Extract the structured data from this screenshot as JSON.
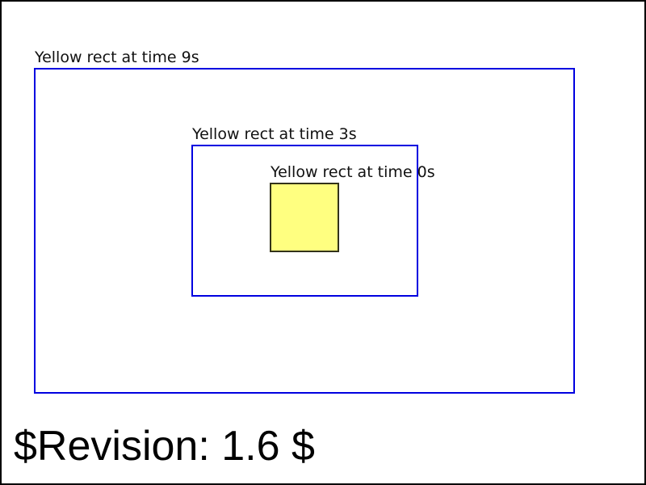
{
  "colors": {
    "frame_border": "#000000",
    "outline_stroke": "#0000e0",
    "square_fill": "#ffff80",
    "square_stroke": "#33331a"
  },
  "diagram": {
    "rect_9s_label": "Yellow rect at time 9s",
    "rect_3s_label": "Yellow rect at time 3s",
    "rect_0s_label": "Yellow rect at time 0s"
  },
  "footer": {
    "revision": "$Revision: 1.6 $"
  }
}
